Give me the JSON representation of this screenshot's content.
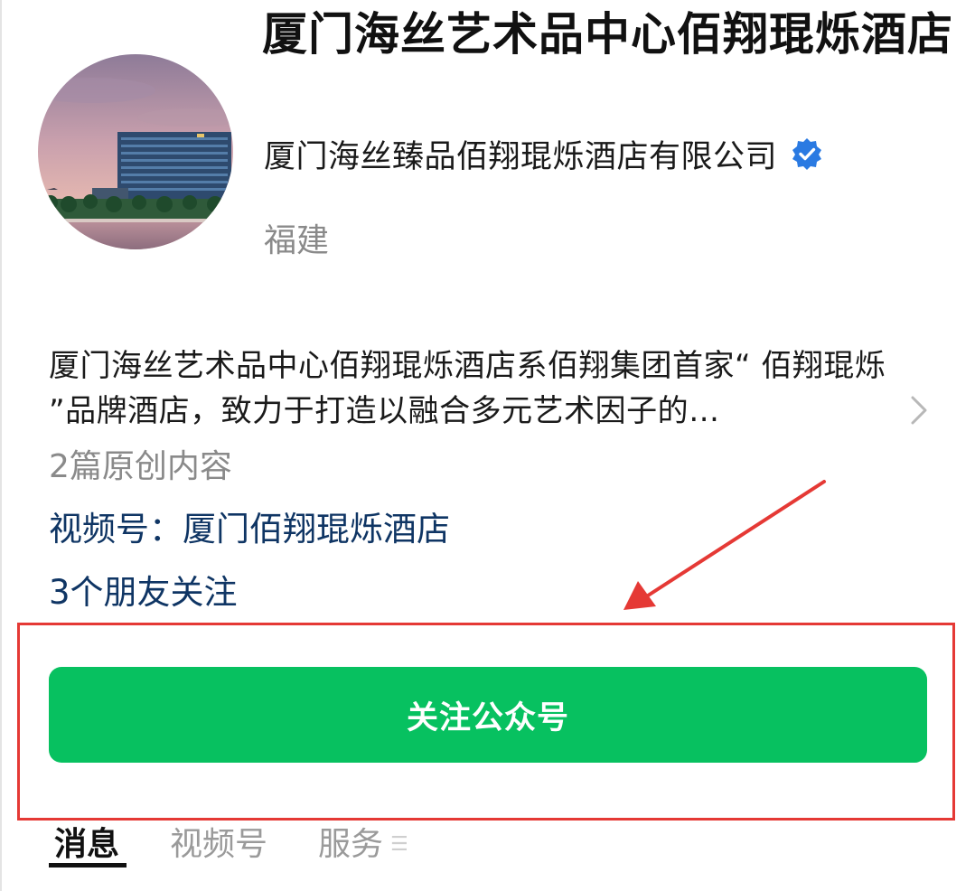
{
  "profile": {
    "name": "厦门海丝艺术品中心佰翔琨烁酒店",
    "company": "厦门海丝臻品佰翔琨烁酒店有限公司",
    "region": "福建",
    "verified_icon": "verified-badge-icon",
    "accent_color": "#2a7ae2"
  },
  "intro": {
    "description": "厦门海丝艺术品中心佰翔琨烁酒店系佰翔集团首家“ 佰翔琨烁 ”品牌酒店，致力于打造以融合多元艺术因子的…",
    "chevron_icon": "chevron-right-icon",
    "original_count": "2篇原创内容",
    "channel_link": "视频号：厦门佰翔琨烁酒店",
    "friends_follow": "3个朋友关注"
  },
  "actions": {
    "follow_label": "关注公众号",
    "follow_color": "#07c160"
  },
  "annotation": {
    "color": "#e53935"
  },
  "tabs": [
    {
      "label": "消息",
      "active": true
    },
    {
      "label": "视频号",
      "active": false
    },
    {
      "label": "服务",
      "active": false
    }
  ],
  "tab_more_icon": "menu-lines-icon"
}
